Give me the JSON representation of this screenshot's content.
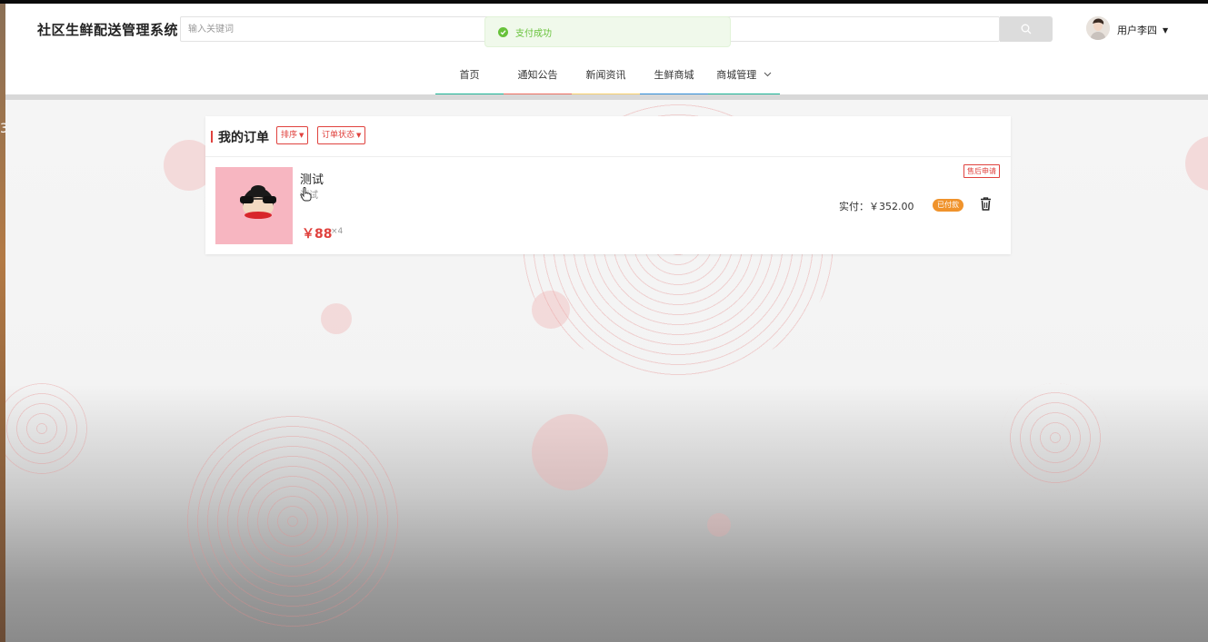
{
  "app": {
    "title": "社区生鲜配送管理系统"
  },
  "search": {
    "placeholder": "输入关键词"
  },
  "user": {
    "name": "用户李四"
  },
  "toast": {
    "message": "支付成功"
  },
  "nav": {
    "items": [
      {
        "label": "首页",
        "color": "#19b394"
      },
      {
        "label": "通知公告",
        "color": "#ec6c5f"
      },
      {
        "label": "新闻资讯",
        "color": "#f7cf6a"
      },
      {
        "label": "生鲜商城",
        "color": "#2e8bd6"
      },
      {
        "label": "商城管理",
        "color": "#19b394"
      }
    ]
  },
  "orders": {
    "title": "我的订单",
    "sort_label": "排序",
    "status_filter_label": "订单状态",
    "items": [
      {
        "name": "测试",
        "desc": "测试",
        "price": "￥88",
        "qty": "×4",
        "after_sale": "售后申请",
        "paid": "实付：￥352.00",
        "status": "已付款"
      }
    ]
  },
  "left_strip": {
    "glyph": "3"
  },
  "colors": {
    "accent": "#e0423e",
    "success": "#67c23a",
    "status_orange": "#f0932c"
  }
}
